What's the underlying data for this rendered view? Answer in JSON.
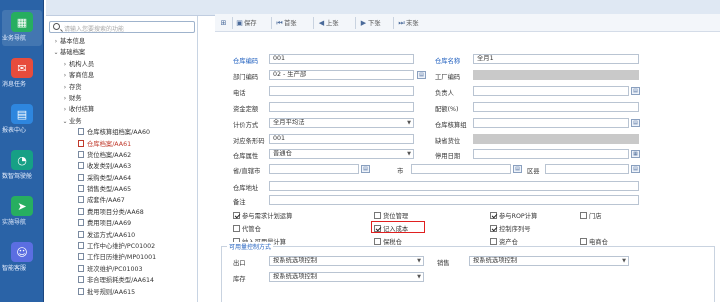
{
  "dock": [
    {
      "label": "业务导航",
      "icon": "grid-icon",
      "color": "#27ae60"
    },
    {
      "label": "消息任务",
      "icon": "message-icon",
      "color": "#e74c3c"
    },
    {
      "label": "报表中心",
      "icon": "report-icon",
      "color": "#2e86de"
    },
    {
      "label": "数智驾驶舱",
      "icon": "chart-icon",
      "color": "#16a085"
    },
    {
      "label": "实施导航",
      "icon": "navigation-icon",
      "color": "#27ae60"
    },
    {
      "label": "智能客服",
      "icon": "service-icon",
      "color": "#5b6ee1"
    }
  ],
  "tree": {
    "search_placeholder": "请输入您要搜索的功能",
    "nodes": [
      {
        "arrow": "›",
        "label": "基本信息",
        "indent": 0,
        "doc": false
      },
      {
        "arrow": "⌄",
        "label": "基础档案",
        "indent": 0,
        "doc": false
      },
      {
        "arrow": "›",
        "label": "机构人员",
        "indent": 1,
        "doc": false
      },
      {
        "arrow": "›",
        "label": "客商信息",
        "indent": 1,
        "doc": false
      },
      {
        "arrow": "›",
        "label": "存货",
        "indent": 1,
        "doc": false
      },
      {
        "arrow": "›",
        "label": "财务",
        "indent": 1,
        "doc": false
      },
      {
        "arrow": "›",
        "label": "收付结算",
        "indent": 1,
        "doc": false
      },
      {
        "arrow": "⌄",
        "label": "业务",
        "indent": 1,
        "doc": false
      },
      {
        "arrow": "",
        "label": "仓库核算组档案/AA60",
        "indent": 2,
        "doc": true
      },
      {
        "arrow": "",
        "label": "仓库档案/AA61",
        "indent": 2,
        "doc": true,
        "selected": true
      },
      {
        "arrow": "",
        "label": "货位档案/AA62",
        "indent": 2,
        "doc": true
      },
      {
        "arrow": "",
        "label": "收发类别/AA63",
        "indent": 2,
        "doc": true
      },
      {
        "arrow": "",
        "label": "采购类型/AA64",
        "indent": 2,
        "doc": true
      },
      {
        "arrow": "",
        "label": "销售类型/AA65",
        "indent": 2,
        "doc": true
      },
      {
        "arrow": "",
        "label": "成套件/AA67",
        "indent": 2,
        "doc": true
      },
      {
        "arrow": "",
        "label": "费用项目分类/AA68",
        "indent": 2,
        "doc": true
      },
      {
        "arrow": "",
        "label": "费用项目/AA69",
        "indent": 2,
        "doc": true
      },
      {
        "arrow": "",
        "label": "发运方式/AA610",
        "indent": 2,
        "doc": true
      },
      {
        "arrow": "",
        "label": "工作中心维护/PC01002",
        "indent": 2,
        "doc": true
      },
      {
        "arrow": "",
        "label": "工作日历维护/MP01001",
        "indent": 2,
        "doc": true
      },
      {
        "arrow": "",
        "label": "班次维护/PC01003",
        "indent": 2,
        "doc": true
      },
      {
        "arrow": "",
        "label": "非合理损耗类型/AA614",
        "indent": 2,
        "doc": true
      },
      {
        "arrow": "",
        "label": "批号规则/AA615",
        "indent": 2,
        "doc": true
      }
    ]
  },
  "toolbar": {
    "buttons": [
      {
        "icon": "save-icon",
        "label": "保存"
      },
      {
        "icon": "first-icon",
        "label": "首张"
      },
      {
        "icon": "prev-icon",
        "label": "上张"
      },
      {
        "icon": "next-icon",
        "label": "下张"
      },
      {
        "icon": "last-icon",
        "label": "末张"
      }
    ]
  },
  "form": {
    "labels": {
      "warehouse_code": "仓库编码",
      "warehouse_name": "仓库名称",
      "dept_code": "部门编码",
      "factory_code": "工厂编码",
      "phone": "电话",
      "manager": "负责人",
      "funds_quota": "资金定额",
      "allocation_rate": "配额(%)",
      "pricing_method": "计价方式",
      "accounting_group": "仓库核算组",
      "counterpart_code": "对应条形码",
      "default_location": "缺省货位",
      "warehouse_attr": "仓库属性",
      "stop_date": "停用日期",
      "province": "省/直辖市",
      "city": "市",
      "district": "区县",
      "address": "仓库地址",
      "remark": "备注",
      "section_title": "可用量控制方式",
      "outbound": "出口",
      "sales": "销售",
      "inventory": "库存"
    },
    "values": {
      "warehouse_code": "001",
      "warehouse_name": "全月1",
      "dept_code": "02 - 生产部",
      "pricing_method": "全月平均法",
      "counterpart_code": "001",
      "warehouse_attr": "普通仓",
      "outbound": "按系统选项控制",
      "sales": "按系统选项控制",
      "inventory": "按系统选项控制"
    },
    "checkboxes": [
      {
        "label": "参与需求计划运算",
        "checked": true
      },
      {
        "label": "货位管理",
        "checked": false
      },
      {
        "label": "参与ROP计算",
        "checked": true
      },
      {
        "label": "门店",
        "checked": false
      },
      {
        "label": "代管仓",
        "checked": false
      },
      {
        "label": "记入成本",
        "checked": true
      },
      {
        "label": "控制序列号",
        "checked": true
      },
      {
        "label": "纳入可用量计算",
        "checked": false
      },
      {
        "label": "保税仓",
        "checked": false
      },
      {
        "label": "资产仓",
        "checked": false
      },
      {
        "label": "电商仓",
        "checked": false
      }
    ],
    "highlight_color": "#e02020"
  }
}
